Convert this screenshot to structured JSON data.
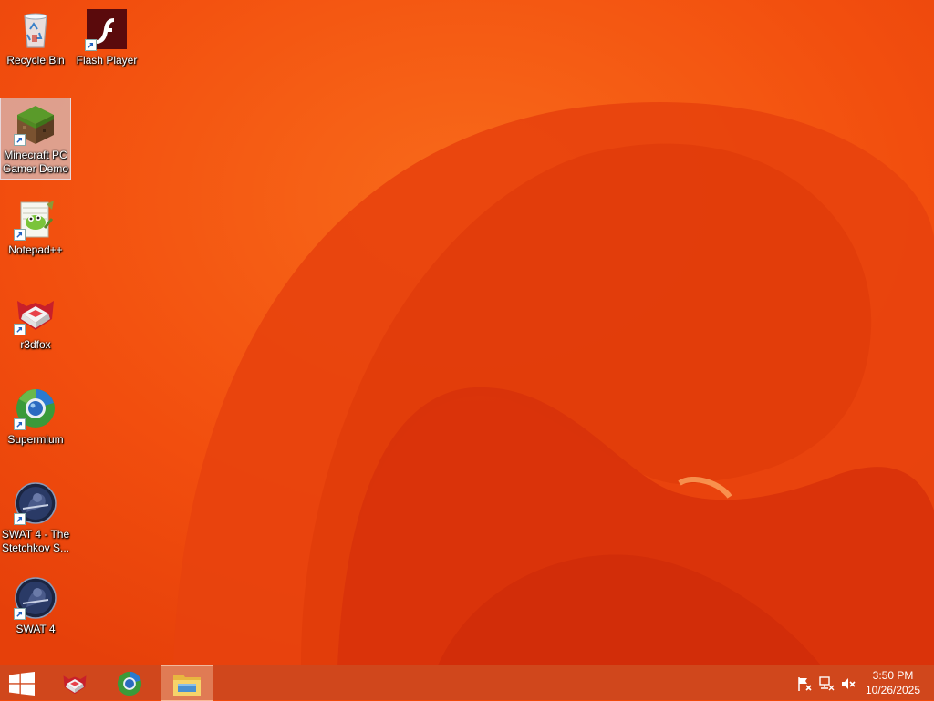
{
  "desktop": {
    "icons": [
      {
        "label": "Recycle Bin",
        "icon": "recycle-bin-icon",
        "shortcut": false,
        "selected": false
      },
      {
        "label": "Flash Player",
        "icon": "flash-player-icon",
        "shortcut": true,
        "selected": false
      },
      {
        "label": "Minecraft PC Gamer Demo",
        "icon": "minecraft-icon",
        "shortcut": true,
        "selected": true
      },
      {
        "label": "Notepad++",
        "icon": "notepad-plus-plus-icon",
        "shortcut": true,
        "selected": false
      },
      {
        "label": "r3dfox",
        "icon": "r3dfox-icon",
        "shortcut": true,
        "selected": false
      },
      {
        "label": "Supermium",
        "icon": "supermium-icon",
        "shortcut": true,
        "selected": false
      },
      {
        "label": "SWAT 4 - The Stetchkov S...",
        "icon": "swat4-expansion-icon",
        "shortcut": true,
        "selected": false
      },
      {
        "label": "SWAT 4",
        "icon": "swat4-icon",
        "shortcut": true,
        "selected": false
      }
    ]
  },
  "taskbar": {
    "start": {
      "icon": "windows-logo-icon"
    },
    "pinned": [
      {
        "name": "r3dfox",
        "icon": "r3dfox-icon",
        "active": false
      },
      {
        "name": "Supermium",
        "icon": "supermium-icon",
        "active": false
      },
      {
        "name": "File Explorer",
        "icon": "file-explorer-icon",
        "active": true
      }
    ],
    "tray": {
      "icons": [
        "action-center-flag-icon",
        "network-icon",
        "volume-muted-icon"
      ],
      "time": "3:50 PM",
      "date": "10/26/2025"
    }
  },
  "colors": {
    "wallpaper_base": "#f04a0c",
    "wallpaper_deep": "#d42a0a",
    "taskbar": "#cd461e"
  }
}
